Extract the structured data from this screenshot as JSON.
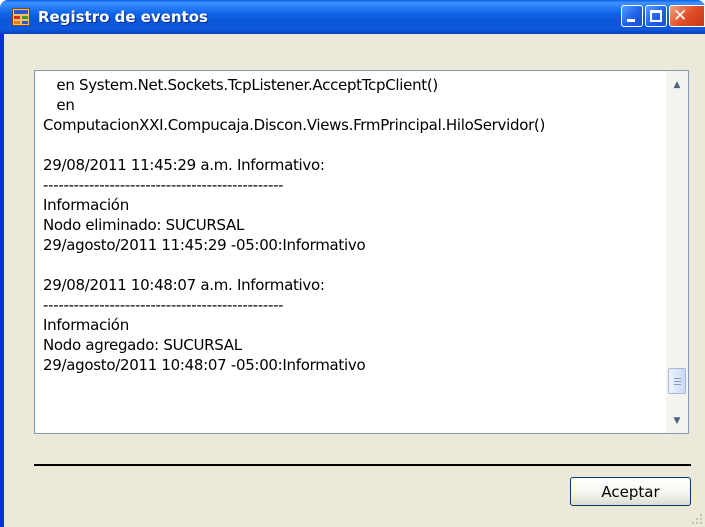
{
  "window": {
    "title": "Registro de eventos",
    "icon": "app-window-icon",
    "controls": [
      "minimize-icon",
      "maximize-icon",
      "close-icon"
    ],
    "close_glyph": "✕"
  },
  "log": {
    "lines": [
      "   en System.Net.Sockets.TcpListener.AcceptTcpClient()",
      "   en",
      "ComputacionXXI.Compucaja.Discon.Views.FrmPrincipal.HiloServidor()",
      "",
      "29/08/2011 11:45:29 a.m. Informativo:",
      "-----------------------------------------------",
      "Información",
      "Nodo eliminado: SUCURSAL",
      "29/agosto/2011 11:45:29 -05:00:Informativo",
      "",
      "29/08/2011 10:48:07 a.m. Informativo:",
      "-----------------------------------------------",
      "Información",
      "Nodo agregado: SUCURSAL",
      "29/agosto/2011 10:48:07 -05:00:Informativo"
    ]
  },
  "scrollbar": {
    "up_glyph": "▲",
    "down_glyph": "▼",
    "position_fraction": 1.0
  },
  "buttons": {
    "accept_label": "Aceptar"
  },
  "colors": {
    "titlebar": "#0a55d8",
    "client_bg": "#ece9d8",
    "close_button": "#e0502a"
  }
}
